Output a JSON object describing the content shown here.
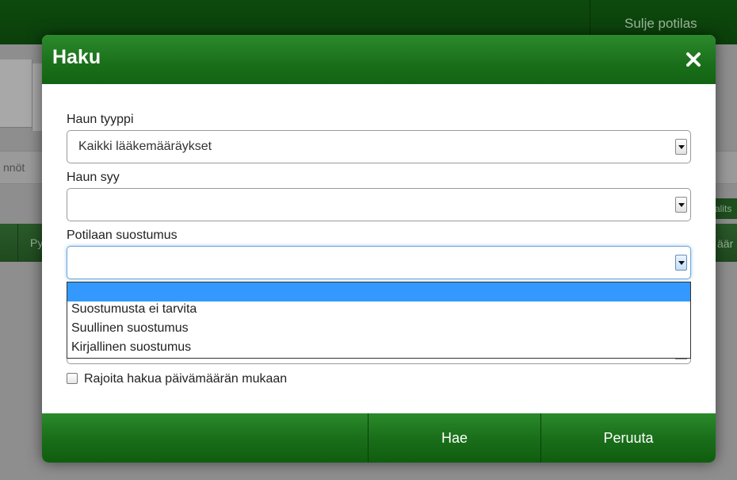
{
  "background": {
    "close_patient_label": "Sulje potilas",
    "left_text": "nnöt",
    "py_text": "Py",
    "right_small": "alits",
    "right_aar": "äär"
  },
  "modal": {
    "title": "Haku",
    "close_icon": "close-icon",
    "fields": {
      "search_type": {
        "label": "Haun tyyppi",
        "value": "Kaikki lääkemääräykset"
      },
      "search_reason": {
        "label": "Haun syy",
        "value": ""
      },
      "patient_consent": {
        "label": "Potilaan suostumus",
        "value": ""
      }
    },
    "consent_options": [
      "",
      "Suostumusta ei tarvita",
      "Suullinen suostumus",
      "Kirjallinen suostumus"
    ],
    "limit_by_date_label": "Rajoita hakua päivämäärän mukaan",
    "buttons": {
      "search": "Hae",
      "cancel": "Peruuta"
    }
  },
  "colors": {
    "header_green": "#1a6f1a",
    "highlight_blue": "#3399ff"
  }
}
